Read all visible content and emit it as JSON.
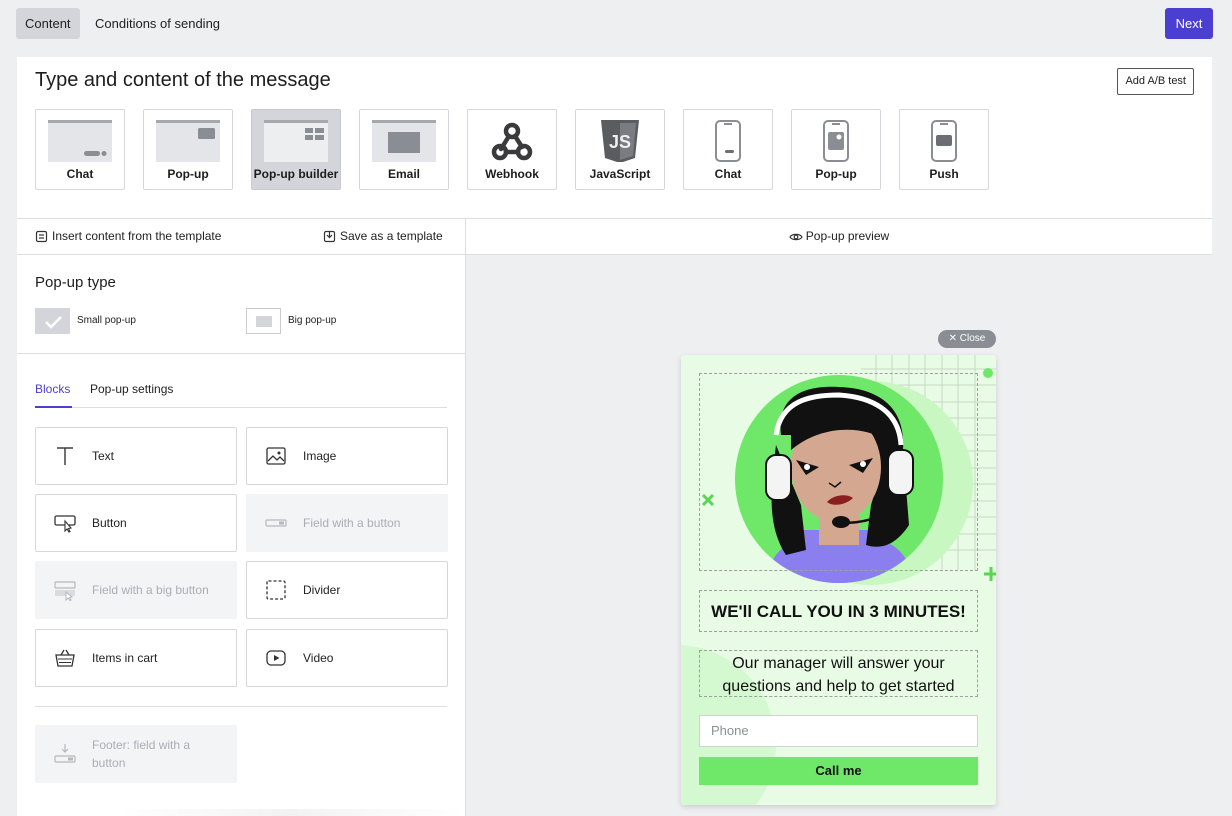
{
  "top": {
    "tabs": [
      {
        "label": "Content"
      },
      {
        "label": "Conditions of sending"
      }
    ],
    "next_label": "Next"
  },
  "card": {
    "title": "Type and content of the message",
    "ab_test_label": "Add A/B test",
    "types": [
      {
        "label": "Chat",
        "icon": "web-chat-icon"
      },
      {
        "label": "Pop-up",
        "icon": "web-popup-icon"
      },
      {
        "label": "Pop-up builder",
        "icon": "popup-builder-icon",
        "selected": true
      },
      {
        "label": "Email",
        "icon": "email-icon"
      },
      {
        "label": "Webhook",
        "icon": "webhook-icon"
      },
      {
        "label": "JavaScript",
        "icon": "javascript-icon"
      },
      {
        "label": "Chat",
        "icon": "mobile-chat-icon"
      },
      {
        "label": "Pop-up",
        "icon": "mobile-popup-icon"
      },
      {
        "label": "Push",
        "icon": "mobile-push-icon"
      }
    ]
  },
  "left": {
    "insert_template": "Insert content from the template",
    "save_template": "Save as a template",
    "popup_type_title": "Pop-up type",
    "small_popup": "Small pop-up",
    "big_popup": "Big pop-up",
    "tabs": [
      {
        "label": "Blocks"
      },
      {
        "label": "Pop-up settings"
      }
    ],
    "blocks": [
      {
        "label": "Text",
        "icon": "text-icon"
      },
      {
        "label": "Image",
        "icon": "image-icon"
      },
      {
        "label": "Button",
        "icon": "button-icon"
      },
      {
        "label": "Field with a button",
        "icon": "field-button-icon",
        "disabled": true
      },
      {
        "label": "Field with a big button",
        "icon": "field-big-button-icon",
        "disabled": true
      },
      {
        "label": "Divider",
        "icon": "divider-icon"
      },
      {
        "label": "Items in cart",
        "icon": "cart-icon"
      },
      {
        "label": "Video",
        "icon": "video-icon"
      }
    ],
    "footer_block": {
      "label": "Footer: field with a button",
      "icon": "footer-field-icon",
      "disabled": true
    }
  },
  "preview": {
    "title": "Pop-up preview",
    "close_label": "Close",
    "heading": "WE'll CALL YOU IN 3 MINUTES!",
    "text": "Our manager will answer your questions and help to get started",
    "phone_placeholder": "Phone",
    "button_label": "Call me"
  },
  "colors": {
    "accent": "#4b3fd1",
    "popup_bg": "#e8fce5",
    "popup_green": "#6fe86a"
  }
}
